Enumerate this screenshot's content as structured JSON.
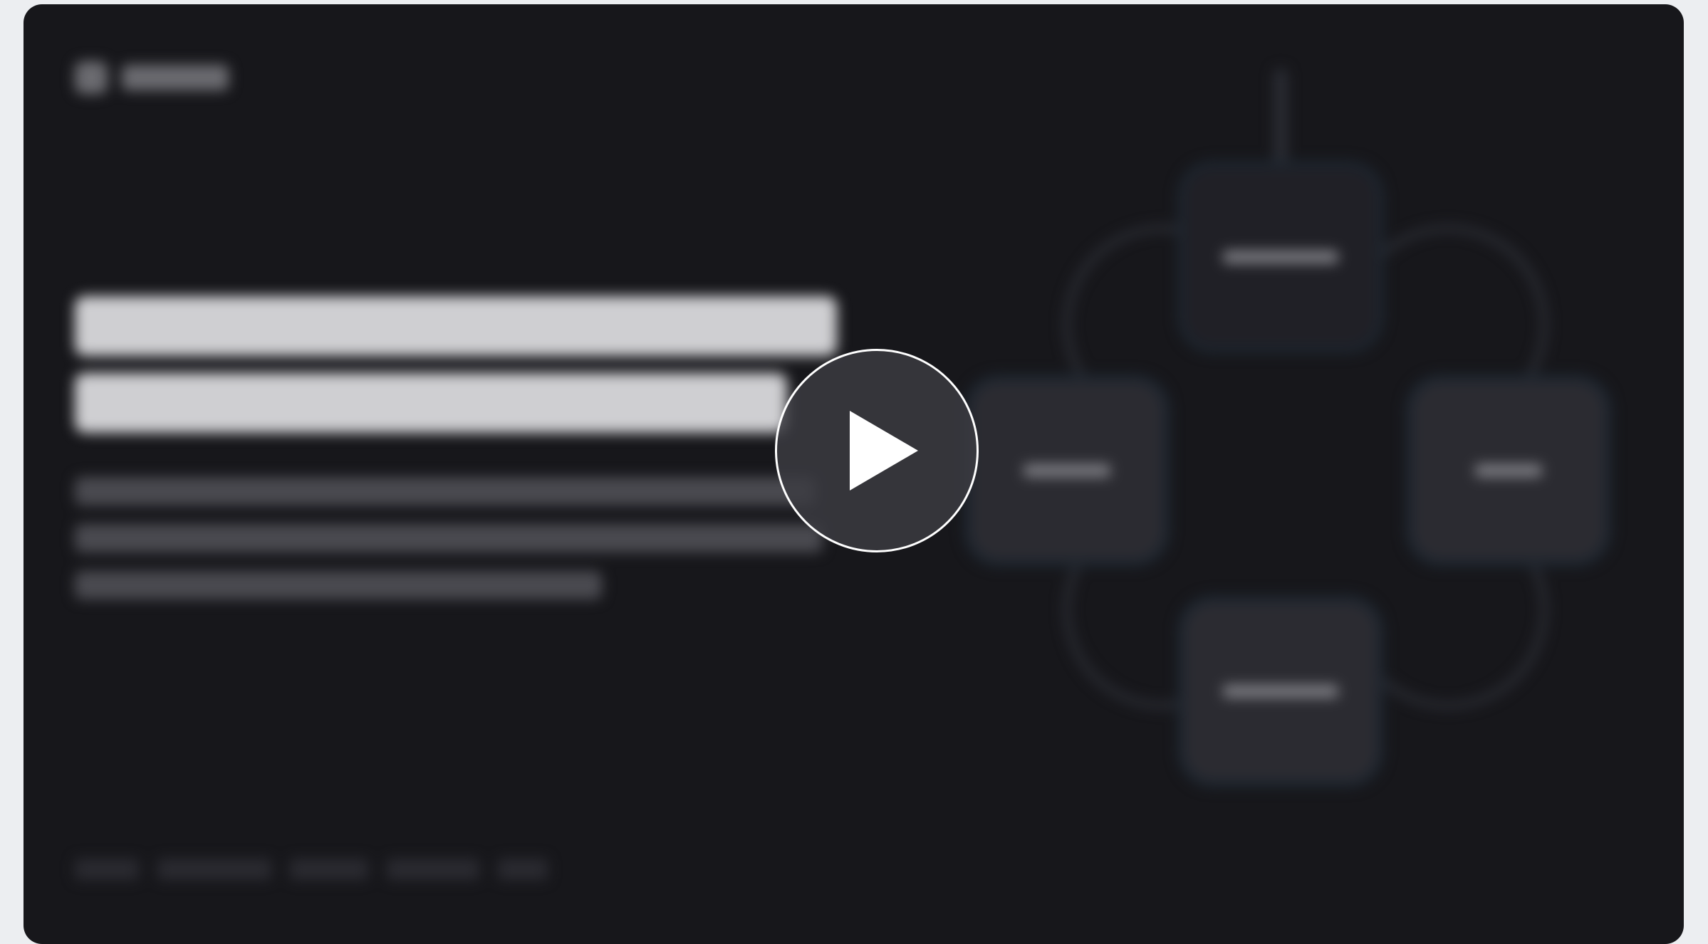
{
  "video": {
    "play_label": ""
  },
  "thumbnail": {
    "logo_text": "",
    "headline": "",
    "subheadline": ""
  }
}
